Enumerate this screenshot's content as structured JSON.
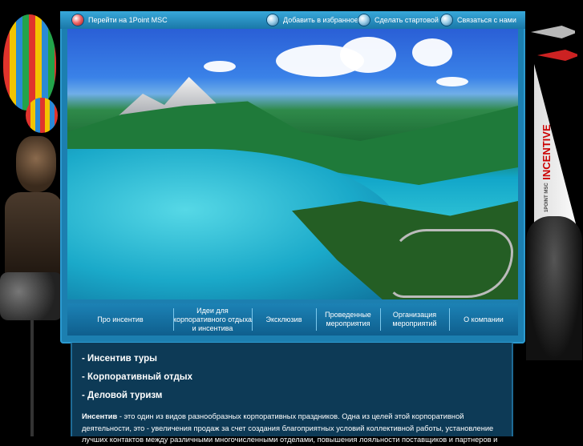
{
  "top_links": [
    {
      "label": "Перейти на 1Point MSC",
      "icon": "red-ball-icon"
    },
    {
      "label": "Добавить в избранное",
      "icon": "blue-ball-icon"
    },
    {
      "label": "Сделать стартовой",
      "icon": "blue-ball-icon"
    },
    {
      "label": "Связаться с нами",
      "icon": "blue-ball-icon"
    }
  ],
  "nav": [
    {
      "label": "Про инсентив"
    },
    {
      "label": "Идеи для корпоративного отдыха и инсентива"
    },
    {
      "label": "Эксклюзив"
    },
    {
      "label": "Проведенные мероприятия"
    },
    {
      "label": "Организация мероприятий"
    },
    {
      "label": "О компании"
    }
  ],
  "content": {
    "links": [
      "- Инсентив туры",
      "- Корпоративный отдых",
      "- Деловой туризм"
    ],
    "intro_bold": "Инсентив",
    "intro_text": " - это один из видов разнообразных корпоративных праздников. Одна из целей этой корпоративной деятельности, это - увеличения продаж за счет создания благоприятных условий коллективной работы, установление лучших контактов между различными многочисленными отделами, повышения лояльности поставщиков и партнеров и"
  },
  "decor": {
    "right_sail_logo_prefix": "1POINT MSC",
    "right_sail_logo": "INCENTIVE"
  },
  "colors": {
    "frame": "#1c7fb0",
    "content_bg": "#0d3a56",
    "page_bg": "#000000"
  }
}
